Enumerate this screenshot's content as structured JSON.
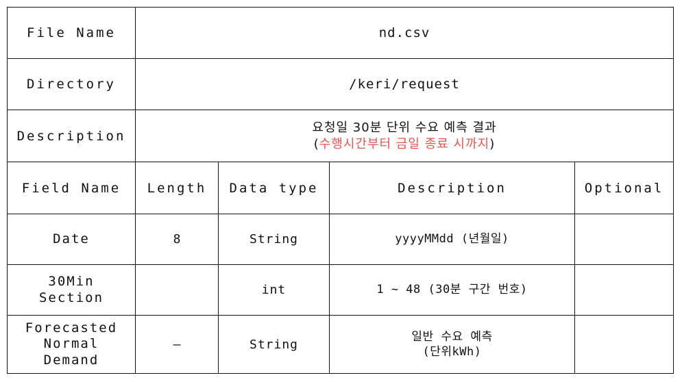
{
  "file_spec": {
    "meta_rows": [
      {
        "label": "File Name",
        "value": "nd.csv"
      },
      {
        "label": "Directory",
        "value": "/keri/request"
      }
    ],
    "description_row": {
      "label": "Description",
      "line1": "요청일 30분 단위 수요 예측 결과",
      "line2_open": "(",
      "line2_highlight": "수행시간부터 금일 종료 시까지",
      "line2_close": ")",
      "highlight_color": "#ec5349"
    },
    "field_table": {
      "headers": {
        "field_name": "Field Name",
        "length": "Length",
        "data_type": "Data type",
        "description": "Description",
        "optional": "Optional"
      },
      "rows": [
        {
          "field_name": "Date",
          "field_name_line2": "",
          "field_name_line3": "",
          "length": "8",
          "data_type": "String",
          "description_line1": "yyyyMMdd (년월일)",
          "description_line2": "",
          "optional": ""
        },
        {
          "field_name": "30Min",
          "field_name_line2": "Section",
          "field_name_line3": "",
          "length": "",
          "data_type": "int",
          "description_line1": "1 ~ 48 (30분 구간 번호)",
          "description_line2": "",
          "optional": ""
        },
        {
          "field_name": "Forecasted",
          "field_name_line2": "Normal",
          "field_name_line3": "Demand",
          "length": "–",
          "data_type": "String",
          "description_line1": "일반 수요 예측",
          "description_line2": "(단위kWh)",
          "optional": ""
        }
      ]
    }
  }
}
